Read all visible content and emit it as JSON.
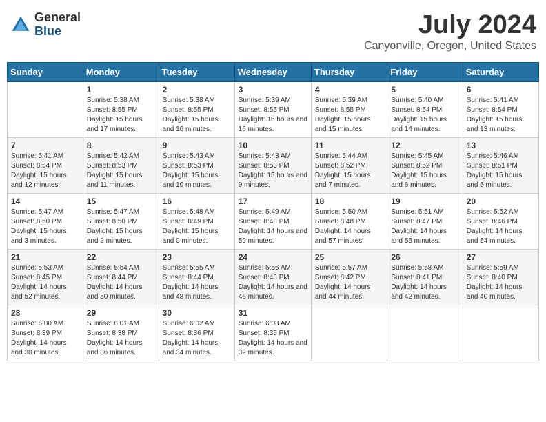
{
  "logo": {
    "general": "General",
    "blue": "Blue"
  },
  "header": {
    "month": "July 2024",
    "location": "Canyonville, Oregon, United States"
  },
  "weekdays": [
    "Sunday",
    "Monday",
    "Tuesday",
    "Wednesday",
    "Thursday",
    "Friday",
    "Saturday"
  ],
  "weeks": [
    [
      {
        "day": "",
        "sunrise": "",
        "sunset": "",
        "daylight": ""
      },
      {
        "day": "1",
        "sunrise": "Sunrise: 5:38 AM",
        "sunset": "Sunset: 8:55 PM",
        "daylight": "Daylight: 15 hours and 17 minutes."
      },
      {
        "day": "2",
        "sunrise": "Sunrise: 5:38 AM",
        "sunset": "Sunset: 8:55 PM",
        "daylight": "Daylight: 15 hours and 16 minutes."
      },
      {
        "day": "3",
        "sunrise": "Sunrise: 5:39 AM",
        "sunset": "Sunset: 8:55 PM",
        "daylight": "Daylight: 15 hours and 16 minutes."
      },
      {
        "day": "4",
        "sunrise": "Sunrise: 5:39 AM",
        "sunset": "Sunset: 8:55 PM",
        "daylight": "Daylight: 15 hours and 15 minutes."
      },
      {
        "day": "5",
        "sunrise": "Sunrise: 5:40 AM",
        "sunset": "Sunset: 8:54 PM",
        "daylight": "Daylight: 15 hours and 14 minutes."
      },
      {
        "day": "6",
        "sunrise": "Sunrise: 5:41 AM",
        "sunset": "Sunset: 8:54 PM",
        "daylight": "Daylight: 15 hours and 13 minutes."
      }
    ],
    [
      {
        "day": "7",
        "sunrise": "Sunrise: 5:41 AM",
        "sunset": "Sunset: 8:54 PM",
        "daylight": "Daylight: 15 hours and 12 minutes."
      },
      {
        "day": "8",
        "sunrise": "Sunrise: 5:42 AM",
        "sunset": "Sunset: 8:53 PM",
        "daylight": "Daylight: 15 hours and 11 minutes."
      },
      {
        "day": "9",
        "sunrise": "Sunrise: 5:43 AM",
        "sunset": "Sunset: 8:53 PM",
        "daylight": "Daylight: 15 hours and 10 minutes."
      },
      {
        "day": "10",
        "sunrise": "Sunrise: 5:43 AM",
        "sunset": "Sunset: 8:53 PM",
        "daylight": "Daylight: 15 hours and 9 minutes."
      },
      {
        "day": "11",
        "sunrise": "Sunrise: 5:44 AM",
        "sunset": "Sunset: 8:52 PM",
        "daylight": "Daylight: 15 hours and 7 minutes."
      },
      {
        "day": "12",
        "sunrise": "Sunrise: 5:45 AM",
        "sunset": "Sunset: 8:52 PM",
        "daylight": "Daylight: 15 hours and 6 minutes."
      },
      {
        "day": "13",
        "sunrise": "Sunrise: 5:46 AM",
        "sunset": "Sunset: 8:51 PM",
        "daylight": "Daylight: 15 hours and 5 minutes."
      }
    ],
    [
      {
        "day": "14",
        "sunrise": "Sunrise: 5:47 AM",
        "sunset": "Sunset: 8:50 PM",
        "daylight": "Daylight: 15 hours and 3 minutes."
      },
      {
        "day": "15",
        "sunrise": "Sunrise: 5:47 AM",
        "sunset": "Sunset: 8:50 PM",
        "daylight": "Daylight: 15 hours and 2 minutes."
      },
      {
        "day": "16",
        "sunrise": "Sunrise: 5:48 AM",
        "sunset": "Sunset: 8:49 PM",
        "daylight": "Daylight: 15 hours and 0 minutes."
      },
      {
        "day": "17",
        "sunrise": "Sunrise: 5:49 AM",
        "sunset": "Sunset: 8:48 PM",
        "daylight": "Daylight: 14 hours and 59 minutes."
      },
      {
        "day": "18",
        "sunrise": "Sunrise: 5:50 AM",
        "sunset": "Sunset: 8:48 PM",
        "daylight": "Daylight: 14 hours and 57 minutes."
      },
      {
        "day": "19",
        "sunrise": "Sunrise: 5:51 AM",
        "sunset": "Sunset: 8:47 PM",
        "daylight": "Daylight: 14 hours and 55 minutes."
      },
      {
        "day": "20",
        "sunrise": "Sunrise: 5:52 AM",
        "sunset": "Sunset: 8:46 PM",
        "daylight": "Daylight: 14 hours and 54 minutes."
      }
    ],
    [
      {
        "day": "21",
        "sunrise": "Sunrise: 5:53 AM",
        "sunset": "Sunset: 8:45 PM",
        "daylight": "Daylight: 14 hours and 52 minutes."
      },
      {
        "day": "22",
        "sunrise": "Sunrise: 5:54 AM",
        "sunset": "Sunset: 8:44 PM",
        "daylight": "Daylight: 14 hours and 50 minutes."
      },
      {
        "day": "23",
        "sunrise": "Sunrise: 5:55 AM",
        "sunset": "Sunset: 8:44 PM",
        "daylight": "Daylight: 14 hours and 48 minutes."
      },
      {
        "day": "24",
        "sunrise": "Sunrise: 5:56 AM",
        "sunset": "Sunset: 8:43 PM",
        "daylight": "Daylight: 14 hours and 46 minutes."
      },
      {
        "day": "25",
        "sunrise": "Sunrise: 5:57 AM",
        "sunset": "Sunset: 8:42 PM",
        "daylight": "Daylight: 14 hours and 44 minutes."
      },
      {
        "day": "26",
        "sunrise": "Sunrise: 5:58 AM",
        "sunset": "Sunset: 8:41 PM",
        "daylight": "Daylight: 14 hours and 42 minutes."
      },
      {
        "day": "27",
        "sunrise": "Sunrise: 5:59 AM",
        "sunset": "Sunset: 8:40 PM",
        "daylight": "Daylight: 14 hours and 40 minutes."
      }
    ],
    [
      {
        "day": "28",
        "sunrise": "Sunrise: 6:00 AM",
        "sunset": "Sunset: 8:39 PM",
        "daylight": "Daylight: 14 hours and 38 minutes."
      },
      {
        "day": "29",
        "sunrise": "Sunrise: 6:01 AM",
        "sunset": "Sunset: 8:38 PM",
        "daylight": "Daylight: 14 hours and 36 minutes."
      },
      {
        "day": "30",
        "sunrise": "Sunrise: 6:02 AM",
        "sunset": "Sunset: 8:36 PM",
        "daylight": "Daylight: 14 hours and 34 minutes."
      },
      {
        "day": "31",
        "sunrise": "Sunrise: 6:03 AM",
        "sunset": "Sunset: 8:35 PM",
        "daylight": "Daylight: 14 hours and 32 minutes."
      },
      {
        "day": "",
        "sunrise": "",
        "sunset": "",
        "daylight": ""
      },
      {
        "day": "",
        "sunrise": "",
        "sunset": "",
        "daylight": ""
      },
      {
        "day": "",
        "sunrise": "",
        "sunset": "",
        "daylight": ""
      }
    ]
  ]
}
